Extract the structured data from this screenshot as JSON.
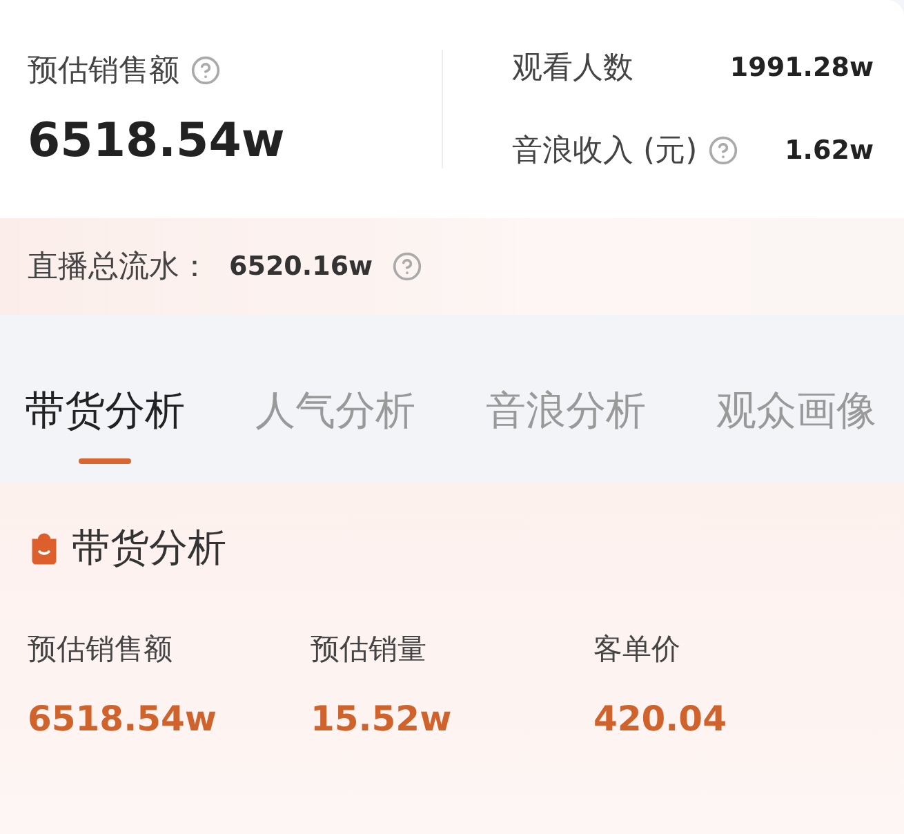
{
  "summary": {
    "label": "预估销售额",
    "value": "6518.54w",
    "stats": [
      {
        "label": "观看人数",
        "value": "1991.28w",
        "help": false
      },
      {
        "label": "音浪收入 (元)",
        "value": "1.62w",
        "help": true
      }
    ]
  },
  "flow": {
    "label": "直播总流水：",
    "value": "6520.16w"
  },
  "tabs": [
    {
      "label": "带货分析",
      "selected": true
    },
    {
      "label": "人气分析",
      "selected": false
    },
    {
      "label": "音浪分析",
      "selected": false
    },
    {
      "label": "观众画像",
      "selected": false
    }
  ],
  "section": {
    "title": "带货分析",
    "metrics": [
      {
        "label": "预估销售额",
        "value": "6518.54w"
      },
      {
        "label": "预估销量",
        "value": "15.52w"
      },
      {
        "label": "客单价",
        "value": "420.04"
      }
    ]
  }
}
